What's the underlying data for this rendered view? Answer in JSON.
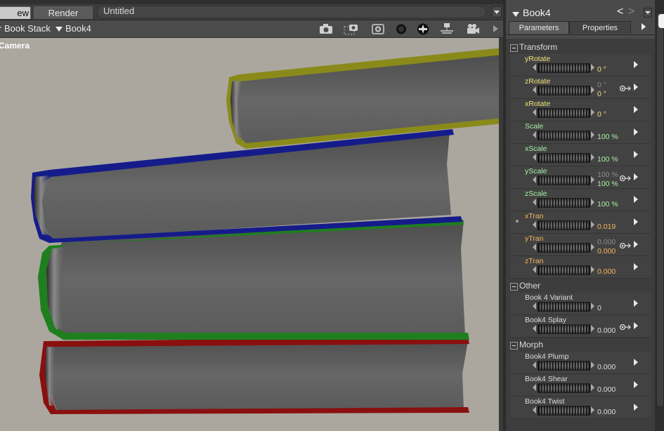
{
  "tabs": {
    "preview": "ew",
    "render": "Render"
  },
  "document_title": "Untitled",
  "toolbar": {
    "scene_label": "r Book Stack",
    "object_label": "Book4",
    "icons": [
      "camera-icon",
      "camera-select-icon",
      "camera-lens-icon",
      "render-sphere-icon",
      "lighting-sphere-icon",
      "camera-dolly-icon",
      "movie-camera-icon",
      "play-arrow-icon"
    ]
  },
  "viewport": {
    "camera_label": "Camera",
    "background_color": "#aba79f",
    "book_colors": {
      "book4": "#8a8a1a",
      "book3": "#151c8a",
      "book2": "#1f7f1f",
      "book1": "#8a1010"
    }
  },
  "panel": {
    "title": "Book4",
    "tabs": {
      "parameters": "Parameters",
      "properties": "Properties"
    },
    "groups": [
      {
        "name": "Transform",
        "params": [
          {
            "name": "yRotate",
            "value": "0 °"
          },
          {
            "name": "zRotate",
            "default": "0 °",
            "value": "0 °"
          },
          {
            "name": "xRotate",
            "value": "0 °"
          },
          {
            "name": "Scale",
            "value": "100 %"
          },
          {
            "name": "xScale",
            "value": "100 %"
          },
          {
            "name": "yScale",
            "default": "100 %",
            "value": "100 %"
          },
          {
            "name": "zScale",
            "value": "100 %"
          },
          {
            "name": "xTran",
            "value": "0.019"
          },
          {
            "name": "yTran",
            "default": "0.000",
            "value": "0.000"
          },
          {
            "name": "zTran",
            "value": "0.000"
          }
        ]
      },
      {
        "name": "Other",
        "params": [
          {
            "name": "Book 4 Variant",
            "value": "0"
          },
          {
            "name": "Book4 Splay",
            "value": "0.000"
          }
        ]
      },
      {
        "name": "Morph",
        "params": [
          {
            "name": "Book4 Plump",
            "value": "0.000"
          },
          {
            "name": "Book4 Shear",
            "value": "0.000"
          },
          {
            "name": "Book4 Twist",
            "value": "0.000"
          }
        ]
      }
    ]
  }
}
